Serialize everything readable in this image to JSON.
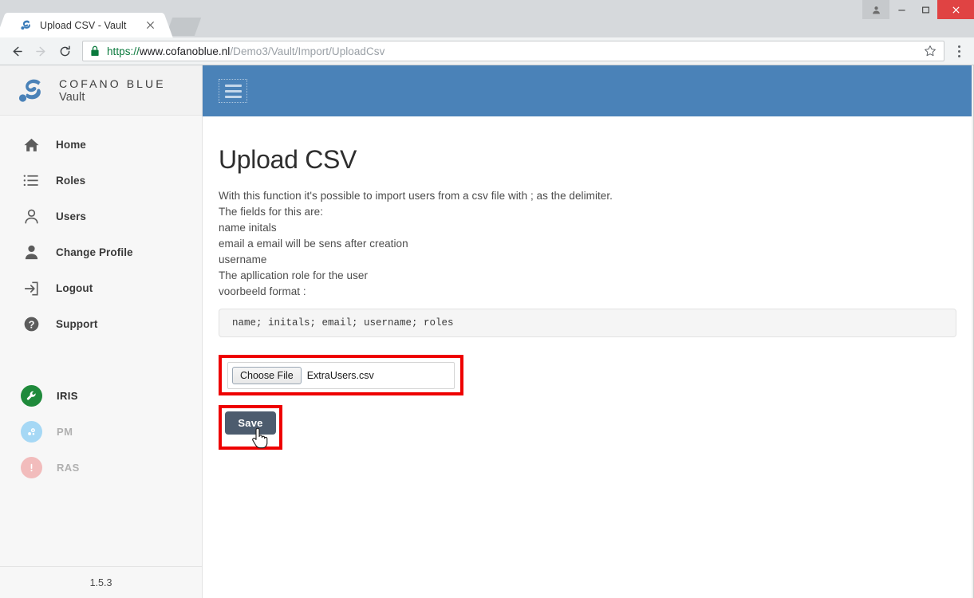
{
  "browser": {
    "tab": {
      "title": "Upload CSV - Vault",
      "favicon_icon": "cofano-favicon-icon",
      "close_icon": "close-icon",
      "newtab_icon": "new-tab-icon"
    },
    "window_controls": {
      "profile_icon": "profile-avatar-icon",
      "minimize_icon": "minimize-icon",
      "maximize_icon": "maximize-icon",
      "close_icon": "window-close-icon",
      "close_color": "#e04343"
    },
    "toolbar": {
      "back_icon": "back-arrow-icon",
      "forward_icon": "forward-arrow-icon",
      "reload_icon": "reload-icon",
      "lock_icon": "lock-icon",
      "star_icon": "bookmark-star-icon",
      "menu_icon": "three-dot-menu-icon",
      "url_scheme": "https://",
      "url_host": "www.cofanoblue.nl",
      "url_path": "/Demo3/Vault/Import/UploadCsv",
      "url_full": "https://www.cofanoblue.nl/Demo3/Vault/Import/UploadCsv"
    }
  },
  "sidebar": {
    "brand": {
      "name": "COFANO BLUE",
      "subtitle": "Vault",
      "logo_icon": "cofano-logo-icon"
    },
    "items": [
      {
        "label": "Home",
        "icon": "home-icon"
      },
      {
        "label": "Roles",
        "icon": "list-icon"
      },
      {
        "label": "Users",
        "icon": "user-outline-icon"
      },
      {
        "label": "Change Profile",
        "icon": "user-filled-icon"
      },
      {
        "label": "Logout",
        "icon": "logout-arrow-icon"
      },
      {
        "label": "Support",
        "icon": "question-circle-icon"
      }
    ],
    "apps": [
      {
        "label": "IRIS",
        "icon": "wrench-icon",
        "color": "#1f8a3b",
        "enabled": true
      },
      {
        "label": "PM",
        "icon": "gear-icon",
        "color": "#a6d8f5",
        "enabled": false
      },
      {
        "label": "RAS",
        "icon": "exclamation-icon",
        "color": "#f2bcbc",
        "enabled": false
      }
    ],
    "footer_version": "1.5.3"
  },
  "topbar": {
    "menu_toggle_icon": "hamburger-menu-icon",
    "background_color": "#4a82b8"
  },
  "main": {
    "title": "Upload CSV",
    "description_lines": [
      "With this function it's possible to import users from a csv file with ; as the delimiter.",
      "The fields for this are:",
      "name initals",
      "email a email will be sens after creation",
      "username",
      "The apllication role for the user",
      "voorbeeld format :"
    ],
    "code_example": "name; initals; email; username; roles",
    "file_field": {
      "button_label": "Choose File",
      "file_name": "ExtraUsers.csv",
      "highlight_color": "#ee0000"
    },
    "save": {
      "label": "Save",
      "button_color": "#4d5c6e",
      "highlight_color": "#ee0000",
      "cursor_icon": "pointer-hand-cursor-icon"
    }
  }
}
